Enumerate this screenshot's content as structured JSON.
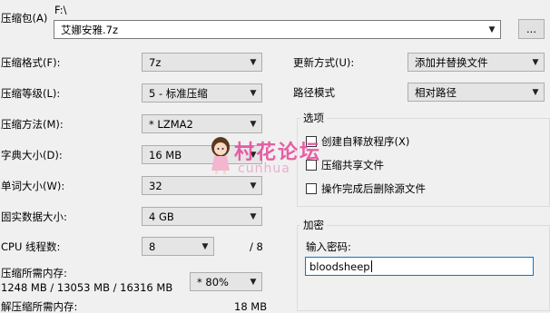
{
  "archive": {
    "label": "压缩包(A)",
    "path": "F:\\",
    "filename": "艾娜安雅.7z",
    "browse_label": "..."
  },
  "left": {
    "format_label": "压缩格式(F):",
    "format_value": "7z",
    "level_label": "压缩等级(L):",
    "level_value": "5 - 标准压缩",
    "method_label": "压缩方法(M):",
    "method_value": "* LZMA2",
    "dict_label": "字典大小(D):",
    "dict_value": "16 MB",
    "word_label": "单词大小(W):",
    "word_value": "32",
    "solid_label": "固实数据大小:",
    "solid_value": "4 GB",
    "cpu_label": "CPU 线程数:",
    "cpu_value": "8",
    "cpu_total": "/ 8",
    "mem_compress_label": "压缩所需内存:",
    "mem_compress_value": "1248 MB / 13053 MB / 16316 MB",
    "mem_percent": "* 80%",
    "mem_decompress_label": "解压缩所需内存:",
    "mem_decompress_value": "18 MB"
  },
  "right": {
    "update_label": "更新方式(U):",
    "update_value": "添加并替换文件",
    "pathmode_label": "路径模式",
    "pathmode_value": "相对路径",
    "options_title": "选项",
    "opt_sfx": "创建自释放程序(X)",
    "opt_shared": "压缩共享文件",
    "opt_delete": "操作完成后删除源文件",
    "encrypt_title": "加密",
    "password_label": "输入密码:",
    "password_value": "bloodsheep"
  },
  "watermark": {
    "text": "村花论坛",
    "sub": "cunhua"
  },
  "colors": {
    "watermark": "#e6459a",
    "focus_border": "#0078d7"
  }
}
